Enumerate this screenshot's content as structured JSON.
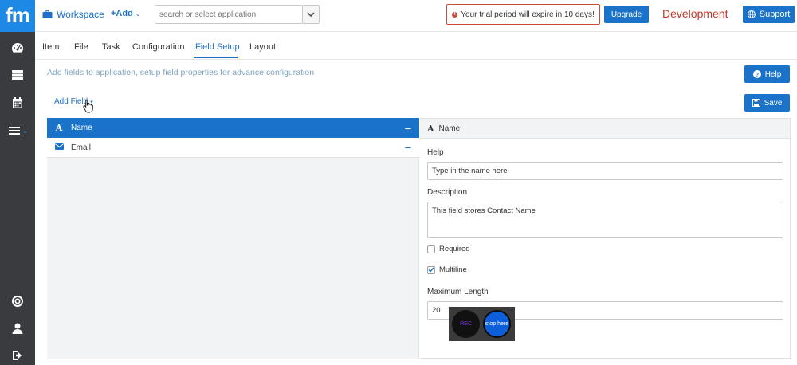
{
  "app": {
    "logo": "fm",
    "workspace_label": "Workspace",
    "add_label": "+Add",
    "search_placeholder": "search or select application",
    "trial_message": "Your trial period will expire in 10 days!",
    "upgrade_label": "Upgrade",
    "environment": "Development",
    "support_label": "Support"
  },
  "tabs": [
    {
      "label": "Item"
    },
    {
      "label": "File"
    },
    {
      "label": "Task"
    },
    {
      "label": "Configuration"
    },
    {
      "label": "Field Setup",
      "active": true
    },
    {
      "label": "Layout"
    }
  ],
  "page": {
    "description": "Add fields to application, setup field properties for advance configuration",
    "help_label": "Help",
    "save_label": "Save",
    "add_field_label": "Add Field"
  },
  "fields": [
    {
      "label": "Name",
      "icon": "text-icon",
      "selected": true
    },
    {
      "label": "Email",
      "icon": "envelope-icon",
      "selected": false
    }
  ],
  "properties": {
    "header_label": "Name",
    "help_label": "Help",
    "help_value": "Type in the name here",
    "description_label": "Description",
    "description_value": "This field stores Contact Name",
    "required_label": "Required",
    "required_checked": false,
    "multiline_label": "Multiline",
    "multiline_checked": true,
    "max_length_label": "Maximum Length",
    "max_length_value": "20"
  },
  "recorder": {
    "rec_label": "REC",
    "stop_label": "stop here"
  },
  "colors": {
    "brand": "#1a73c9",
    "alert": "#c74b3f",
    "rail": "#3a3b3e"
  }
}
